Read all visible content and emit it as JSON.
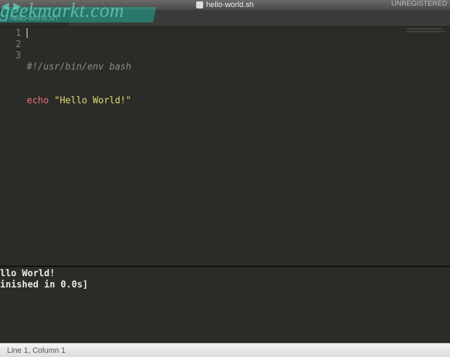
{
  "window": {
    "title": "hello-world.sh",
    "registration": "UNREGISTERED"
  },
  "tab": {
    "label": "hello-world.sh"
  },
  "editor": {
    "line_numbers": [
      "1",
      "2",
      "3"
    ],
    "lines": {
      "l1_shebang": "#!/usr/bin/env bash",
      "l2_cmd": "echo",
      "l2_space": " ",
      "l2_str": "\"Hello World!\"",
      "l3": ""
    }
  },
  "output": {
    "line1": "llo World!",
    "line2": "inished in 0.0s]"
  },
  "status": {
    "cursor_position": "Line 1, Column 1"
  },
  "watermark": {
    "text": "geekmarkt.com"
  }
}
